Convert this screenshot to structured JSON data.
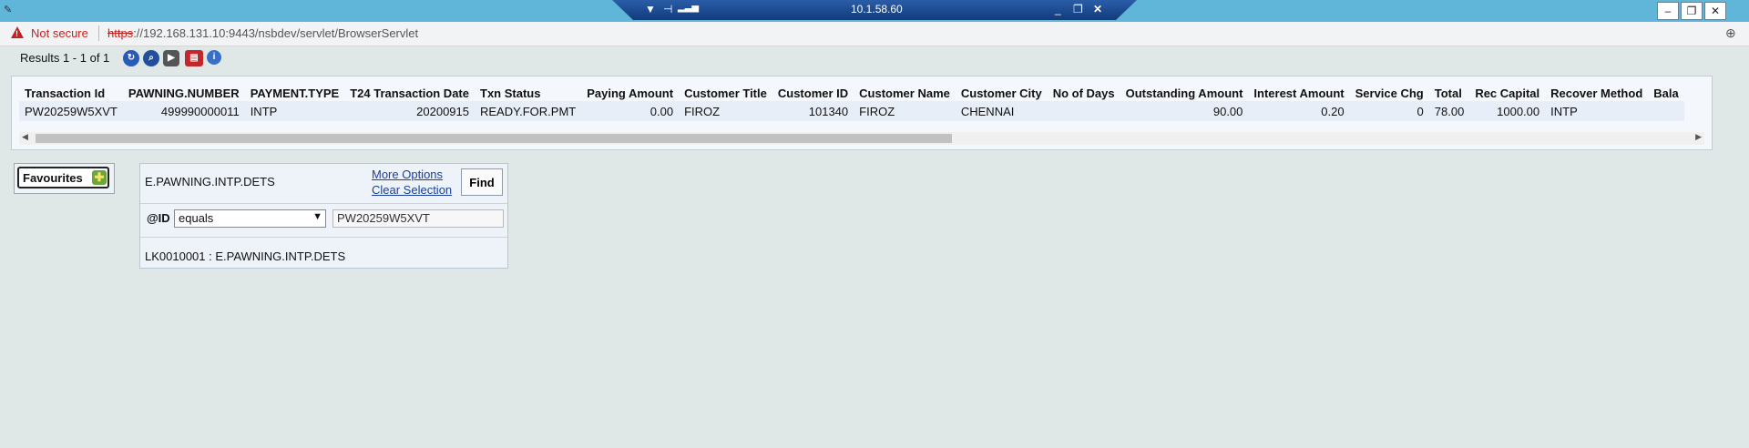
{
  "remote_bar": {
    "host": "10.1.58.60"
  },
  "address_bar": {
    "security_label": "Not secure",
    "url_scheme": "https",
    "url_rest": "://192.168.131.10:9443/nsbdev/servlet/BrowserServlet"
  },
  "results": {
    "summary": "Results 1 - 1 of 1"
  },
  "table": {
    "columns": [
      "Transaction Id",
      "PAWNING.NUMBER",
      "PAYMENT.TYPE",
      "T24 Transaction Date",
      "Txn Status",
      "Paying Amount",
      "Customer Title",
      "Customer ID",
      "Customer Name",
      "Customer City",
      "No of Days",
      "Outstanding Amount",
      "Interest Amount",
      "Service Chg",
      "Total",
      "Rec Capital",
      "Recover Method",
      "Bala"
    ],
    "rows": [
      [
        "PW20259W5XVT",
        "499990000011",
        "INTP",
        "20200915",
        "READY.FOR.PMT",
        "0.00",
        "FIROZ",
        "101340",
        "FIROZ",
        "CHENNAI",
        "",
        "90.00",
        "0.20",
        "0",
        "78.00",
        "1000.00",
        "INTP",
        ""
      ]
    ]
  },
  "favourites": {
    "label": "Favourites"
  },
  "enquiry": {
    "name": "E.PAWNING.INTP.DETS",
    "more_options": "More Options",
    "clear_selection": "Clear Selection",
    "find_label": "Find",
    "field_label": "@ID",
    "operator": "equals",
    "value": "PW20259W5XVT",
    "status": "LK0010001 : E.PAWNING.INTP.DETS"
  }
}
